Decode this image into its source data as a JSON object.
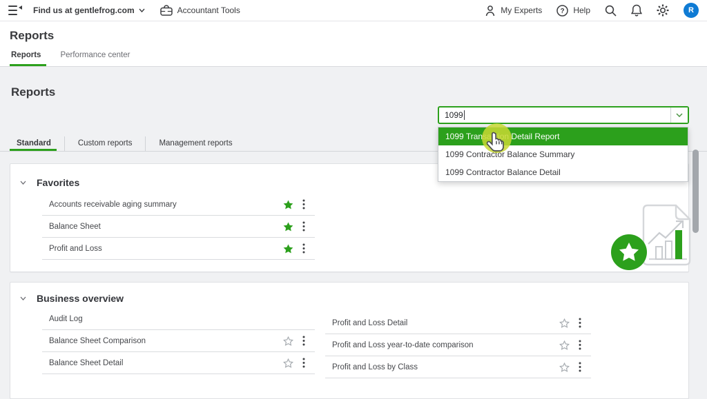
{
  "topbar": {
    "company_selector_label": "Find us at gentlefrog.com",
    "accountant_tools_label": "Accountant Tools",
    "my_experts_label": "My Experts",
    "help_label": "Help",
    "avatar_initial": "R"
  },
  "page_header": {
    "title": "Reports",
    "tabs": [
      {
        "label": "Reports"
      },
      {
        "label": "Performance center"
      }
    ]
  },
  "reports_page": {
    "heading": "Reports",
    "search": {
      "value": "1099"
    },
    "search_dropdown": [
      {
        "label": "1099 Transaction Detail Report"
      },
      {
        "label": "1099 Contractor Balance Summary"
      },
      {
        "label": "1099 Contractor Balance Detail"
      }
    ],
    "report_tabs": [
      {
        "label": "Standard"
      },
      {
        "label": "Custom reports"
      },
      {
        "label": "Management reports"
      }
    ],
    "favorites": {
      "title": "Favorites",
      "rows": [
        {
          "label": "Accounts receivable aging summary"
        },
        {
          "label": "Balance Sheet"
        },
        {
          "label": "Profit and Loss"
        }
      ]
    },
    "business_overview": {
      "title": "Business overview",
      "left_rows": [
        {
          "label": "Audit Log"
        },
        {
          "label": "Balance Sheet Comparison"
        },
        {
          "label": "Balance Sheet Detail"
        }
      ],
      "right_rows": [
        {
          "label": "Profit and Loss Detail"
        },
        {
          "label": "Profit and Loss year-to-date comparison"
        },
        {
          "label": "Profit and Loss by Class"
        }
      ]
    }
  },
  "colors": {
    "accent_green": "#2ca01c",
    "avatar_blue": "#0f7bd4",
    "click_highlight": "#c8d832"
  }
}
